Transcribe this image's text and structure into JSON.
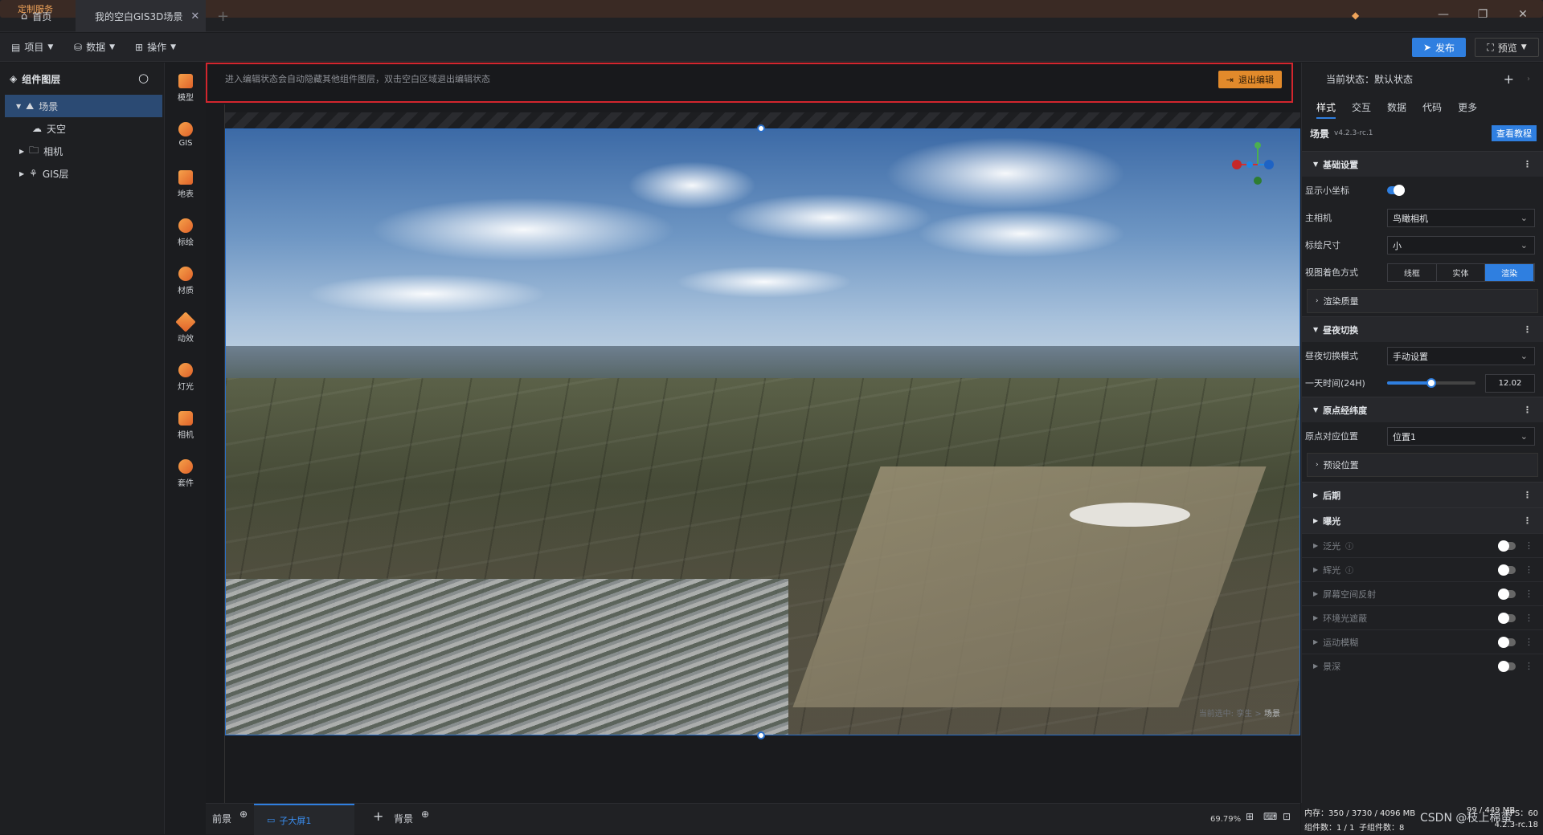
{
  "titlebar": {
    "home_tab": "首页",
    "scene_tab": "我的空白GIS3D场景",
    "custom_service": "定制服务"
  },
  "toolbar": {
    "menu_project": "项目",
    "menu_data": "数据",
    "menu_operate": "操作",
    "publish": "发布",
    "preview": "预览"
  },
  "layers": {
    "title": "组件图层",
    "items": [
      "场景",
      "天空",
      "相机",
      "GIS层"
    ]
  },
  "components": [
    "模型",
    "GIS",
    "地表",
    "标绘",
    "材质",
    "动效",
    "灯光",
    "相机",
    "套件"
  ],
  "canvas": {
    "notice": "进入编辑状态会自动隐藏其他组件图层，双击空白区域退出编辑状态",
    "exit_edit": "退出编辑",
    "selection_prefix": "当前选中:",
    "selection_a": "孪生",
    "selection_b": "场景"
  },
  "bottombar": {
    "foreground": "前景",
    "child_screen": "子大屏1",
    "background": "背景",
    "zoom": "69.79%"
  },
  "right": {
    "current_state_label": "当前状态：",
    "current_state_value": "默认状态",
    "tabs": [
      "样式",
      "交互",
      "数据",
      "代码",
      "更多"
    ],
    "scene_title": "场景",
    "version": "v4.2.3-rc.1",
    "tutorial": "查看教程",
    "basic_settings": "基础设置",
    "show_axes": "显示小坐标",
    "main_camera": "主相机",
    "main_camera_value": "鸟瞰相机",
    "plot_size": "标绘尺寸",
    "plot_size_value": "小",
    "view_shading": "视图着色方式",
    "shading_options": [
      "线框",
      "实体",
      "渲染"
    ],
    "render_quality": "渲染质量",
    "day_night": "昼夜切换",
    "day_night_mode": "昼夜切换模式",
    "day_night_mode_value": "手动设置",
    "day_time": "一天时间(24H)",
    "day_time_value": "12.02",
    "day_time_fraction": 0.5,
    "origin": "原点经纬度",
    "origin_position": "原点对应位置",
    "origin_position_value": "位置1",
    "preset_position": "预设位置",
    "post": "后期",
    "exposure": "曝光",
    "effects": [
      "泛光",
      "辉光",
      "屏幕空间反射",
      "环境光遮蔽",
      "运动模糊",
      "景深"
    ]
  },
  "stats": {
    "memory": "内存：350 / 3730 / 4096 MB",
    "mem2": "99 / 449 MB",
    "fps": "FPS：60",
    "components": "组件数：1 / 1",
    "children": "子组件数：8",
    "ver": "4.2.3-rc.18",
    "watermark": "CSDN @枝上棉蛮"
  }
}
